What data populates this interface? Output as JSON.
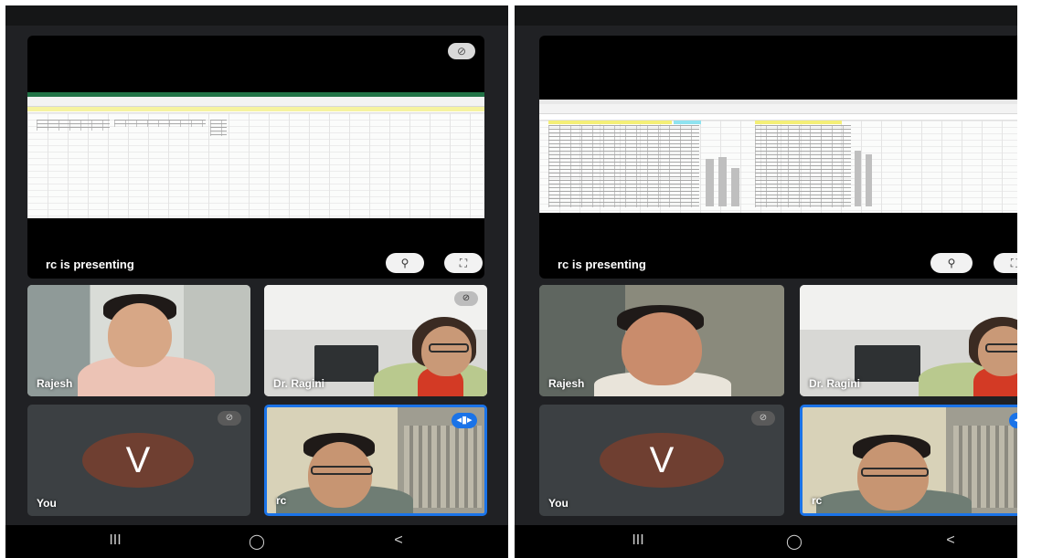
{
  "screens": [
    {
      "presenting_text": "rc is presenting",
      "participants": [
        {
          "name": "Rajesh",
          "type": "camera"
        },
        {
          "name": "Dr. Ragini",
          "type": "camera"
        },
        {
          "name": "You",
          "type": "avatar",
          "initial": "V",
          "avatar_color": "#6f3f31"
        },
        {
          "name": "rc",
          "type": "camera",
          "speaking": true
        }
      ]
    },
    {
      "presenting_text": "rc is presenting",
      "participants": [
        {
          "name": "Rajesh",
          "type": "camera"
        },
        {
          "name": "Dr. Ragini",
          "type": "camera"
        },
        {
          "name": "You",
          "type": "avatar",
          "initial": "V",
          "avatar_color": "#6f3f31"
        },
        {
          "name": "rc",
          "type": "camera",
          "speaking": true
        }
      ]
    }
  ],
  "icons": {
    "mic_off": "mic-off-icon",
    "pin": "pin-icon",
    "fullscreen": "fullscreen-icon",
    "speaking": "audio-wave-icon"
  },
  "nav": {
    "recents": "III",
    "home": "◯",
    "back": "<"
  },
  "colors": {
    "accent": "#1a73e8",
    "excel_green": "#217346",
    "background": "#202124"
  }
}
